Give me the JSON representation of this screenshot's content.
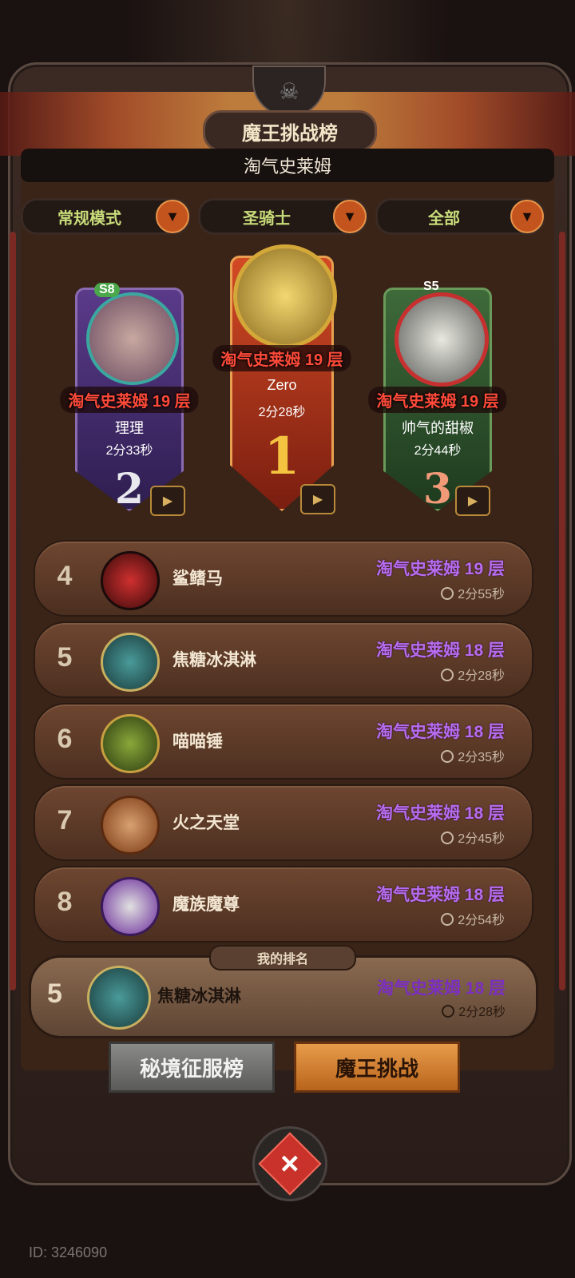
{
  "header": {
    "title": "魔王挑战榜",
    "subtitle": "淘气史莱姆"
  },
  "filters": [
    {
      "label": "常规模式"
    },
    {
      "label": "圣骑士"
    },
    {
      "label": "全部"
    }
  ],
  "podium": {
    "first": {
      "badge": "",
      "floor": "淘气史莱姆 19 层",
      "name": "Zero",
      "time": "2分28秒",
      "rank": "1"
    },
    "second": {
      "badge": "S8",
      "floor": "淘气史莱姆 19 层",
      "name": "理理",
      "time": "2分33秒",
      "rank": "2"
    },
    "third": {
      "badge": "S5",
      "floor": "淘气史莱姆 19 层",
      "name": "帅气的甜椒",
      "time": "2分44秒",
      "rank": "3"
    }
  },
  "list": [
    {
      "rank": "4",
      "name": "鲨鳍马",
      "floor": "淘气史莱姆 19 层",
      "time": "2分55秒",
      "color": "#a01c1c"
    },
    {
      "rank": "5",
      "name": "焦糖冰淇淋",
      "floor": "淘气史莱姆 18 层",
      "time": "2分28秒",
      "color": "#2f6a6a"
    },
    {
      "rank": "6",
      "name": "喵喵锤",
      "floor": "淘气史莱姆 18 层",
      "time": "2分35秒",
      "color": "#6a7a2a"
    },
    {
      "rank": "7",
      "name": "火之天堂",
      "floor": "淘气史莱姆 18 层",
      "time": "2分45秒",
      "color": "#a45a24"
    },
    {
      "rank": "8",
      "name": "魔族魔尊",
      "floor": "淘气史莱姆 18 层",
      "time": "2分54秒",
      "color": "#6a2a9a"
    }
  ],
  "my_rank": {
    "label": "我的排名",
    "rank": "5",
    "name": "焦糖冰淇淋",
    "floor": "淘气史莱姆 18 层",
    "time": "2分28秒"
  },
  "tabs": {
    "conquest": "秘境征服榜",
    "demon_challenge": "魔王挑战"
  },
  "footer": {
    "uid": "ID: 3246090"
  },
  "icons": {
    "close": "close-icon",
    "dropdown": "chevron-down-icon",
    "video": "video-icon",
    "clock": "clock-icon"
  }
}
